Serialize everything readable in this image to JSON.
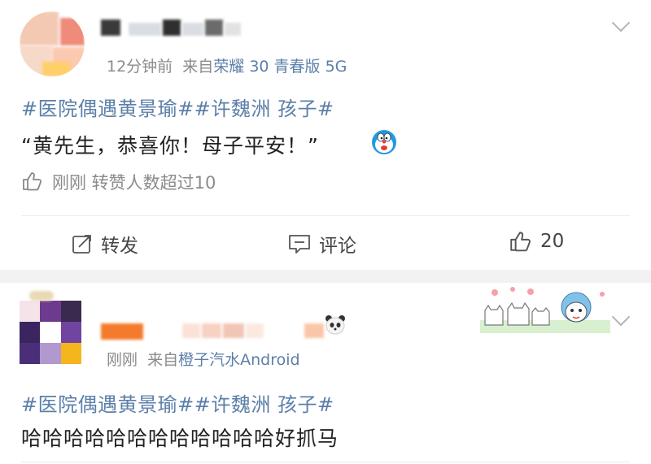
{
  "posts": [
    {
      "time": "12分钟前",
      "source_prefix": "来自",
      "source": "荣耀 30 青春版 5G",
      "topic": "#医院偶遇黄景瑜##许魏洲 孩子#",
      "text": "“黄先生，恭喜你！母子平安！”",
      "like_info": "刚刚 转赞人数超过10",
      "actions": {
        "repost": "转发",
        "comment": "评论",
        "like_count": "20"
      },
      "emoji_icon": "doraemon-emoji-icon"
    },
    {
      "time": "刚刚",
      "source_prefix": "来自",
      "source": "橙子汽水Android",
      "topic": "#医院偶遇黄景瑜##许魏洲 孩子#",
      "text": "哈哈哈哈哈哈哈哈哈哈哈哈好抓马"
    }
  ],
  "colors": {
    "link": "#5b7fa8",
    "meta": "#8b8b8b",
    "separator": "#f2f2f2"
  }
}
